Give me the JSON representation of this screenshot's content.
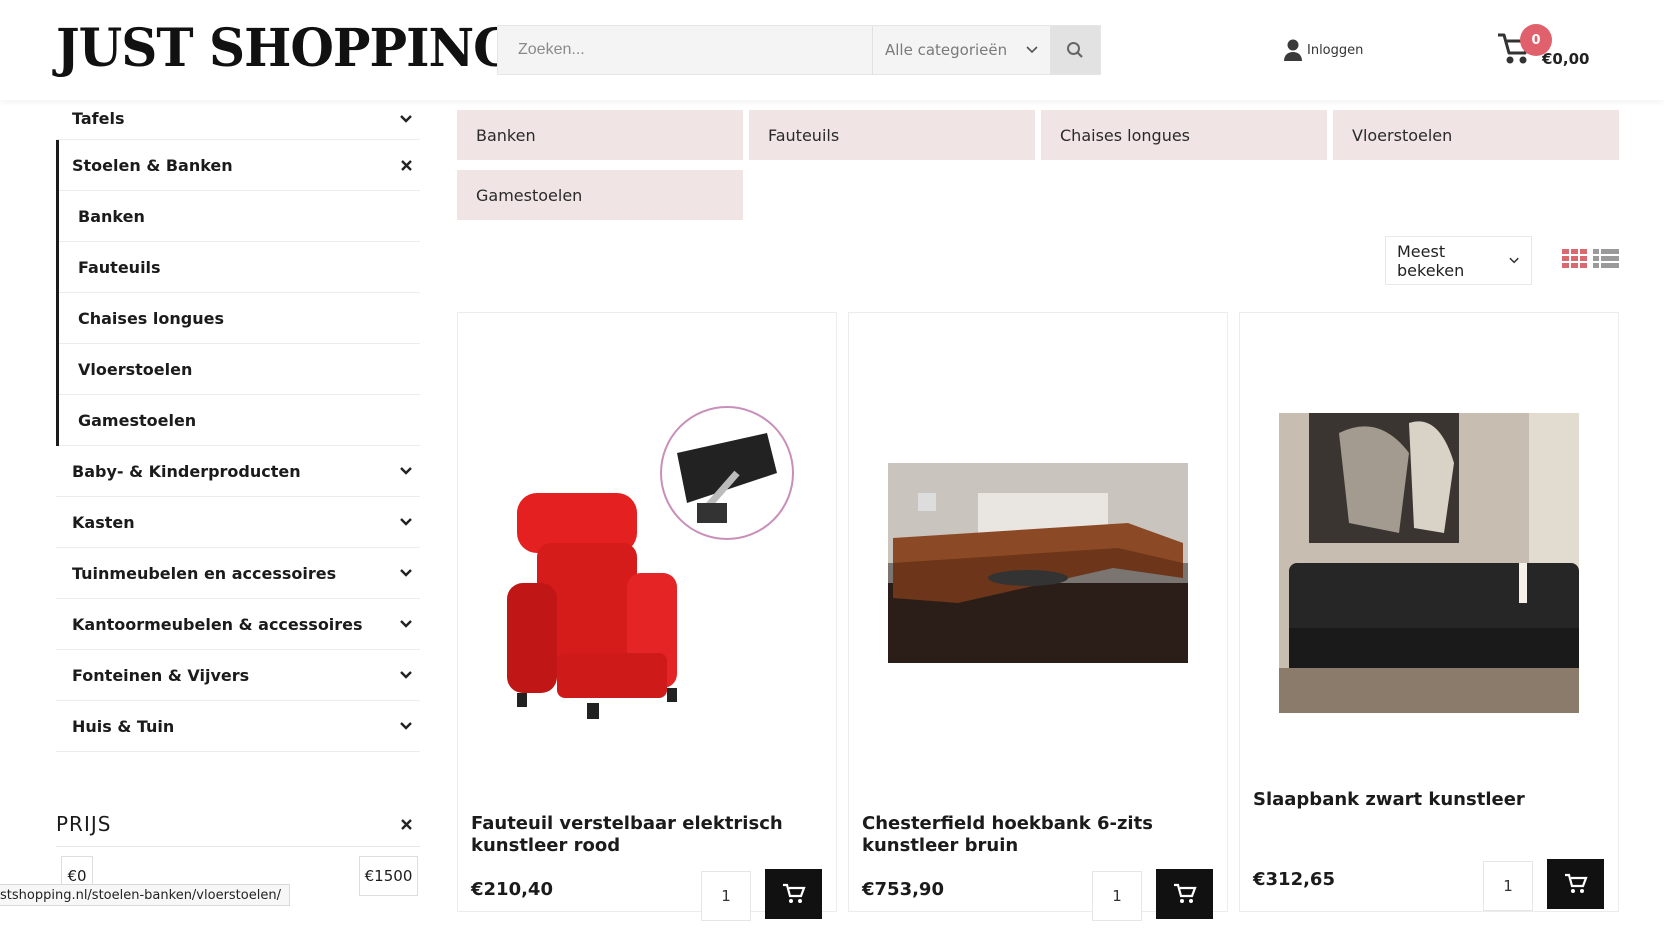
{
  "header": {
    "logo": "JUST SHOPPING",
    "search": {
      "placeholder": "Zoeken...",
      "category": "Alle categorieën"
    },
    "login": "Inloggen",
    "cart": {
      "count": "0",
      "total": "€0,00"
    }
  },
  "sidebar": {
    "categories_top": [
      {
        "label": "Tafels",
        "state": "collapsed"
      }
    ],
    "active": {
      "label": "Stoelen & Banken",
      "sub": [
        "Banken",
        "Fauteuils",
        "Chaises longues",
        "Vloerstoelen",
        "Gamestoelen"
      ]
    },
    "categories_bottom": [
      "Baby- & Kinderproducten",
      "Kasten",
      "Tuinmeubelen en accessoires",
      "Kantoormeubelen & accessoires",
      "Fonteinen & Vijvers",
      "Huis & Tuin"
    ],
    "price": {
      "title": "PRIJS",
      "min": "€0",
      "max": "€1500"
    }
  },
  "status_url": "stshopping.nl/stoelen-banken/vloerstoelen/",
  "main": {
    "chips": [
      "Banken",
      "Fauteuils",
      "Chaises longues",
      "Vloerstoelen",
      "Gamestoelen"
    ],
    "sort": "Meest bekeken",
    "products": [
      {
        "name": "Fauteuil verstelbaar elektrisch kunstleer rood",
        "price": "€210,40",
        "qty": "1"
      },
      {
        "name": "Chesterfield hoekbank 6-zits kunstleer bruin",
        "price": "€753,90",
        "qty": "1"
      },
      {
        "name": "Slaapbank zwart kunstleer",
        "price": "€312,65",
        "qty": "1"
      }
    ]
  },
  "colors": {
    "accent": "#e0616b",
    "chip_bg": "#f0e4e4",
    "grid_icon": "#d9686f",
    "list_icon": "#9a9a9a"
  }
}
